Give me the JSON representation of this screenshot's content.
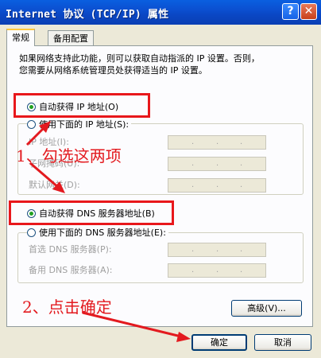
{
  "window": {
    "title": "Internet 协议 (TCP/IP) 属性",
    "help_label": "?",
    "close_label": "✕"
  },
  "tabs": [
    {
      "label": "常规"
    },
    {
      "label": "备用配置"
    }
  ],
  "description": {
    "line1": "如果网络支持此功能，则可以获取自动指派的 IP 设置。否则，",
    "line2": "您需要从网络系统管理员处获得适当的 IP 设置。"
  },
  "ip_section": {
    "auto_label": "自动获得 IP 地址(O)",
    "manual_label": "使用下面的 IP 地址(S):",
    "selected": "auto",
    "fields": [
      {
        "label": "IP 地址(I):",
        "value": "  .  .  ."
      },
      {
        "label": "子网掩码(U):",
        "value": "  .  .  ."
      },
      {
        "label": "默认网关(D):",
        "value": "  .  .  ."
      }
    ]
  },
  "dns_section": {
    "auto_label": "自动获得 DNS 服务器地址(B)",
    "manual_label": "使用下面的 DNS 服务器地址(E):",
    "selected": "auto",
    "fields": [
      {
        "label": "首选 DNS 服务器(P):",
        "value": "  .  .  ."
      },
      {
        "label": "备用 DNS 服务器(A):",
        "value": "  .  .  ."
      }
    ]
  },
  "buttons": {
    "advanced": "高级(V)...",
    "ok": "确定",
    "cancel": "取消"
  },
  "annotations": {
    "step1": "1、勾选这两项",
    "step2": "2、点击确定",
    "color": "#e31a1f"
  }
}
